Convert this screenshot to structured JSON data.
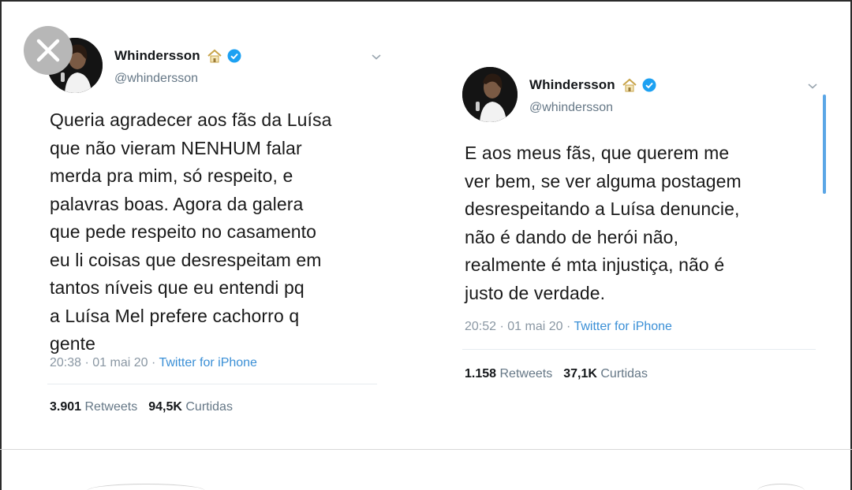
{
  "close": {
    "icon": "close-x-icon"
  },
  "tweets": [
    {
      "display_name": "Whindersson",
      "handle": "@whindersson",
      "text": "Queria agradecer aos fãs da Luísa\nque não vieram NENHUM falar\nmerda pra mim, só respeito, e\npalavras boas. Agora da galera\nque pede respeito no casamento\neu li coisas que desrespeitam em\ntantos níveis que eu entendi pq\na Luísa Mel prefere cachorro q\ngente",
      "time": "20:38 · 01 mai 20 · ",
      "source": "Twitter for iPhone",
      "retweets_count": "3.901",
      "retweets_label": "Retweets",
      "likes_count": "94,5K",
      "likes_label": "Curtidas"
    },
    {
      "display_name": "Whindersson",
      "handle": "@whindersson",
      "text": "E aos meus fãs, que querem me\nver bem, se ver alguma postagem\ndesrespeitando a Luísa denuncie,\nnão é dando de herói não,\nrealmente é mta injustiça, não é\njusto de verdade.",
      "time": "20:52 · 01 mai 20 · ",
      "source": "Twitter for iPhone",
      "retweets_count": "1.158",
      "retweets_label": "Retweets",
      "likes_count": "37,1K",
      "likes_label": "Curtidas"
    }
  ],
  "colors": {
    "link": "#3a8fd6",
    "verified": "#1da1f2",
    "muted": "#657786",
    "scroll_accent": "#5aa6e6"
  },
  "icons": [
    "avatar-photo",
    "house-emoji-icon",
    "verified-badge-icon",
    "chevron-down-icon"
  ]
}
